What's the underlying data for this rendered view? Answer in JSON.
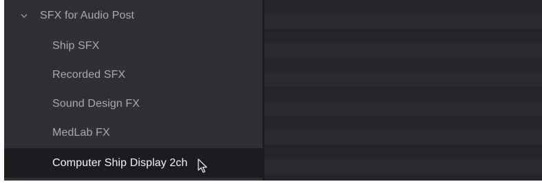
{
  "tree": {
    "parent": {
      "label": "SFX for Audio Post",
      "icon": "chevron-down-icon",
      "expanded": true
    },
    "children": [
      {
        "label": "Ship SFX",
        "selected": false
      },
      {
        "label": "Recorded SFX",
        "selected": false
      },
      {
        "label": "Sound Design FX",
        "selected": false
      },
      {
        "label": "MedLab FX",
        "selected": false
      },
      {
        "label": "Computer Ship Display 2ch",
        "selected": true
      }
    ]
  },
  "cursor": {
    "icon": "mouse-pointer-icon"
  },
  "colors": {
    "panel_bg": "#2e3035",
    "selected_bg": "#1a1c20",
    "text": "#a9abb0",
    "selected_text": "#f4f5f7",
    "content_bg": "#25272b"
  }
}
